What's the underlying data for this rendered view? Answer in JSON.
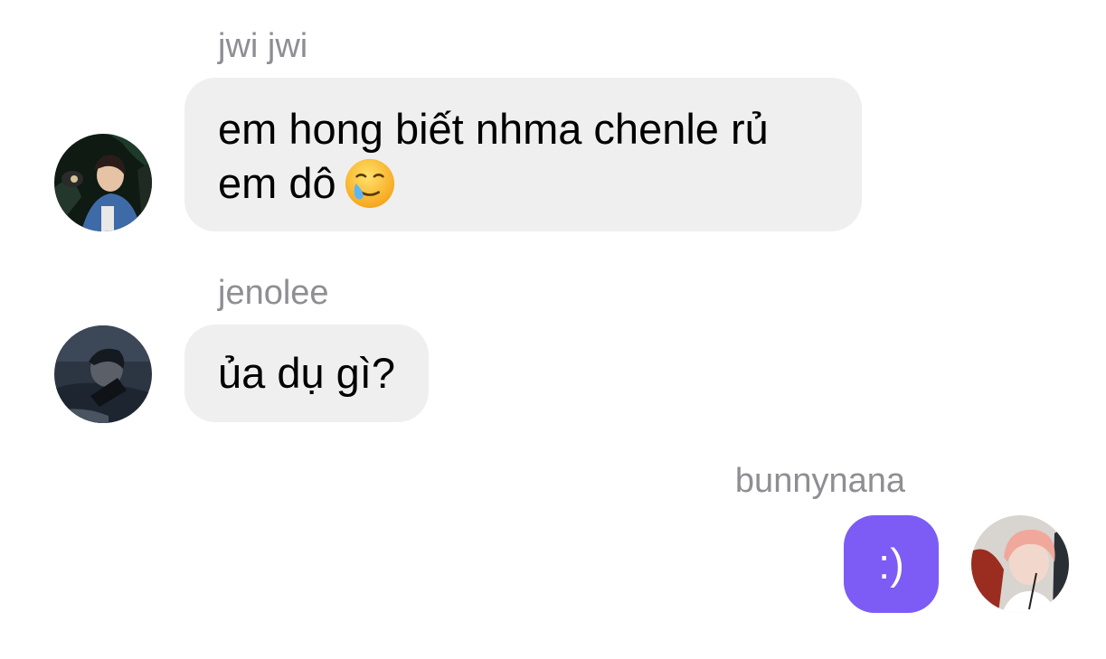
{
  "messages": [
    {
      "sender": "jwi jwi",
      "line1": "em hong biết nhma chenle rủ",
      "line2": "em dô",
      "emoji": "smiling-face-with-tear",
      "avatar": "jwi-jwi-avatar"
    },
    {
      "sender": "jenolee",
      "text": "ủa dụ gì?",
      "avatar": "jenolee-avatar"
    },
    {
      "sender": "bunnynana",
      "text": ":)",
      "avatar": "bunnynana-avatar",
      "bubble_color": "#7c5cf5"
    }
  ],
  "colors": {
    "incoming_bubble": "#efefef",
    "outgoing_bubble": "#7c5cf5",
    "sender_name": "#8e8e93"
  }
}
